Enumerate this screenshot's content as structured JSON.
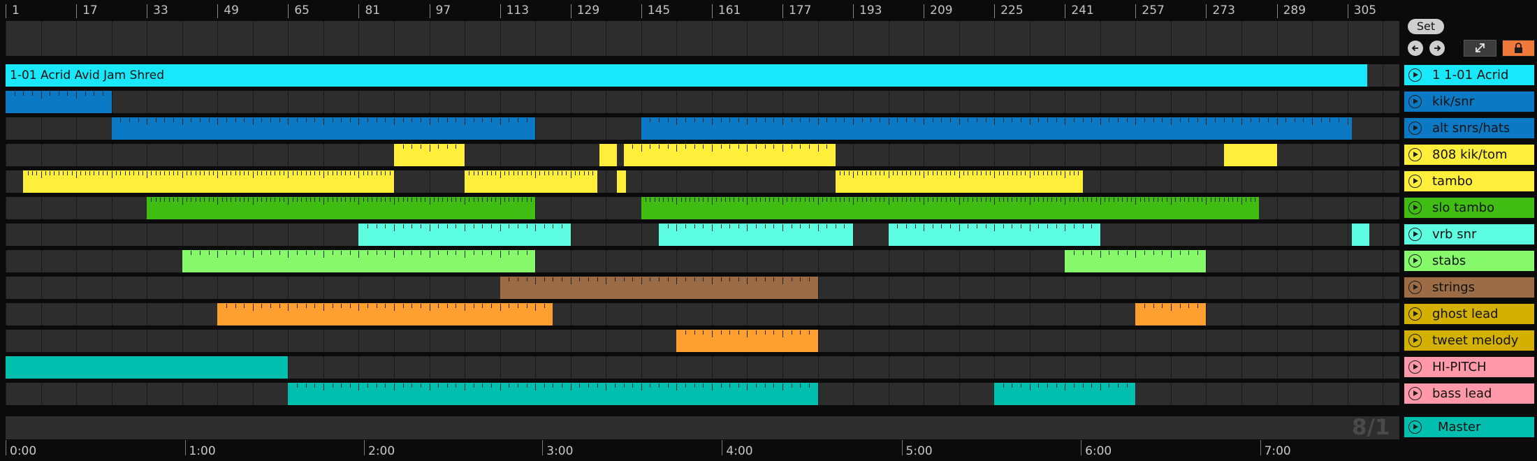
{
  "ruler": {
    "bars": [
      "1",
      "17",
      "33",
      "49",
      "65",
      "81",
      "97",
      "113",
      "129",
      "145",
      "161",
      "177",
      "193",
      "209",
      "225",
      "241",
      "257",
      "273",
      "289",
      "305"
    ]
  },
  "controls": {
    "set_label": "Set",
    "back_icon": "arrow-left-icon",
    "forward_icon": "arrow-right-icon",
    "expand_icon": "expand-icon",
    "lock_icon": "lock-icon",
    "lock_color": "#f07a3c"
  },
  "tracks": [
    {
      "label": "1 1-01 Acrid",
      "color": "#19e8fb",
      "clips": [
        {
          "start": 1,
          "end": 309.5,
          "title": "1-01 Acrid Avid Jam Shred",
          "tick_every": 0
        }
      ]
    },
    {
      "label": "kik/snr",
      "color": "#0b79c4",
      "clips": [
        {
          "start": 1,
          "end": 25,
          "tick_every": 2
        }
      ]
    },
    {
      "label": "alt snrs/hats",
      "color": "#0b79c4",
      "clips": [
        {
          "start": 25,
          "end": 121,
          "tick_every": 2
        },
        {
          "start": 145,
          "end": 306,
          "tick_every": 2
        }
      ]
    },
    {
      "label": "808 kik/tom",
      "color": "#ffef3a",
      "clips": [
        {
          "start": 89,
          "end": 105,
          "tick_every": 2
        },
        {
          "start": 135.5,
          "end": 139.5,
          "tick_every": 0
        },
        {
          "start": 141,
          "end": 189,
          "tick_every": 2
        },
        {
          "start": 277,
          "end": 289,
          "tick_every": 0
        }
      ]
    },
    {
      "label": "tambo",
      "color": "#ffef3a",
      "clips": [
        {
          "start": 5,
          "end": 89,
          "tick_every": 1
        },
        {
          "start": 105,
          "end": 135,
          "tick_every": 1
        },
        {
          "start": 139.5,
          "end": 141.5,
          "tick_every": 0
        },
        {
          "start": 189,
          "end": 245,
          "tick_every": 1
        }
      ]
    },
    {
      "label": "slo tambo",
      "color": "#3fbd12",
      "clips": [
        {
          "start": 33,
          "end": 121,
          "tick_every": 1
        },
        {
          "start": 145,
          "end": 285,
          "tick_every": 1
        }
      ]
    },
    {
      "label": "vrb snr",
      "color": "#5dfde2",
      "clips": [
        {
          "start": 81,
          "end": 129,
          "tick_every": 2
        },
        {
          "start": 149,
          "end": 193,
          "tick_every": 2
        },
        {
          "start": 201,
          "end": 249,
          "tick_every": 2
        },
        {
          "start": 306,
          "end": 310,
          "tick_every": 0
        }
      ]
    },
    {
      "label": "stabs",
      "color": "#86fa6a",
      "clips": [
        {
          "start": 41,
          "end": 121,
          "tick_every": 2
        },
        {
          "start": 241,
          "end": 273,
          "tick_every": 2
        }
      ]
    },
    {
      "label": "strings",
      "color": "#9b6c46",
      "clips": [
        {
          "start": 113,
          "end": 185,
          "tick_every": 2
        }
      ]
    },
    {
      "label": "ghost lead",
      "color": "#ff9f2f",
      "clips": [
        {
          "start": 49,
          "end": 125,
          "tick_every": 2
        },
        {
          "start": 257,
          "end": 273,
          "tick_every": 2
        }
      ]
    },
    {
      "label": "tweet melody",
      "color": "#ff9f2f",
      "clips": [
        {
          "start": 153,
          "end": 185,
          "tick_every": 2
        }
      ]
    },
    {
      "label": "HI-PITCH",
      "color": "#00bfaf",
      "clips": [
        {
          "start": 1,
          "end": 65,
          "tick_every": 0
        }
      ]
    },
    {
      "label": "bass lead",
      "color": "#00bfaf",
      "clips": [
        {
          "start": 65,
          "end": 185,
          "tick_every": 2
        },
        {
          "start": 225,
          "end": 257,
          "tick_every": 2
        }
      ]
    }
  ],
  "track_button_colors": {
    "1 1-01 Acrid": "#19e8fb",
    "kik/snr": "#0b79c4",
    "alt snrs/hats": "#0b79c4",
    "808 kik/tom": "#ffef3a",
    "tambo": "#ffef3a",
    "slo tambo": "#3fbd12",
    "vrb snr": "#5dfde2",
    "stabs": "#86fa6a",
    "strings": "#9b6c46",
    "ghost lead": "#d4b100",
    "tweet melody": "#d4b100",
    "HI-PITCH": "#ff99aa",
    "bass lead": "#ff99aa"
  },
  "master": {
    "label": "Master",
    "color": "#00bfaf",
    "time_signature": "8/1"
  },
  "time_ruler": {
    "labels": [
      {
        "text": "0:00",
        "bar": 1
      },
      {
        "text": "1:00",
        "bar": 41.6
      },
      {
        "text": "2:00",
        "bar": 82.2
      },
      {
        "text": "3:00",
        "bar": 122.6
      },
      {
        "text": "4:00",
        "bar": 163.3
      },
      {
        "text": "5:00",
        "bar": 204
      },
      {
        "text": "6:00",
        "bar": 244.6
      },
      {
        "text": "7:00",
        "bar": 285.2
      }
    ]
  }
}
